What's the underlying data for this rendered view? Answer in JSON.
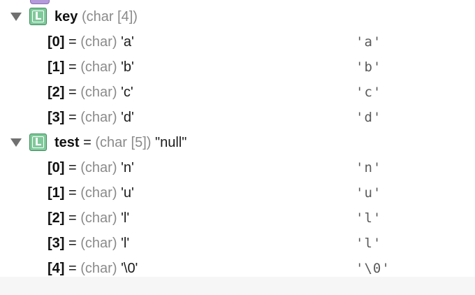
{
  "variables": [
    {
      "name": "key",
      "equals": "",
      "type": "(char [4])",
      "value": "",
      "badge": "L",
      "expanded": true,
      "children": [
        {
          "index": "[0]",
          "equals": "=",
          "type": "(char)",
          "value": "'a'",
          "summary": "'a'"
        },
        {
          "index": "[1]",
          "equals": "=",
          "type": "(char)",
          "value": "'b'",
          "summary": "'b'"
        },
        {
          "index": "[2]",
          "equals": "=",
          "type": "(char)",
          "value": "'c'",
          "summary": "'c'"
        },
        {
          "index": "[3]",
          "equals": "=",
          "type": "(char)",
          "value": "'d'",
          "summary": "'d'"
        }
      ]
    },
    {
      "name": "test",
      "equals": "=",
      "type": "(char [5])",
      "value": "\"null\"",
      "badge": "L",
      "expanded": true,
      "children": [
        {
          "index": "[0]",
          "equals": "=",
          "type": "(char)",
          "value": "'n'",
          "summary": "'n'"
        },
        {
          "index": "[1]",
          "equals": "=",
          "type": "(char)",
          "value": "'u'",
          "summary": "'u'"
        },
        {
          "index": "[2]",
          "equals": "=",
          "type": "(char)",
          "value": "'l'",
          "summary": "'l'"
        },
        {
          "index": "[3]",
          "equals": "=",
          "type": "(char)",
          "value": "'l'",
          "summary": "'l'"
        },
        {
          "index": "[4]",
          "equals": "=",
          "type": "(char)",
          "value": "'\\0'",
          "summary": "'\\0'"
        }
      ]
    }
  ],
  "colors": {
    "local_badge": "#7ec99a",
    "local_badge_border": "#3f8a5c",
    "type_text": "#8a8a8a",
    "summary_text": "#5a5a5a"
  },
  "icons": {
    "disclosure": "disclosure-triangle-down-icon",
    "local_variable": "local-variable-icon"
  }
}
